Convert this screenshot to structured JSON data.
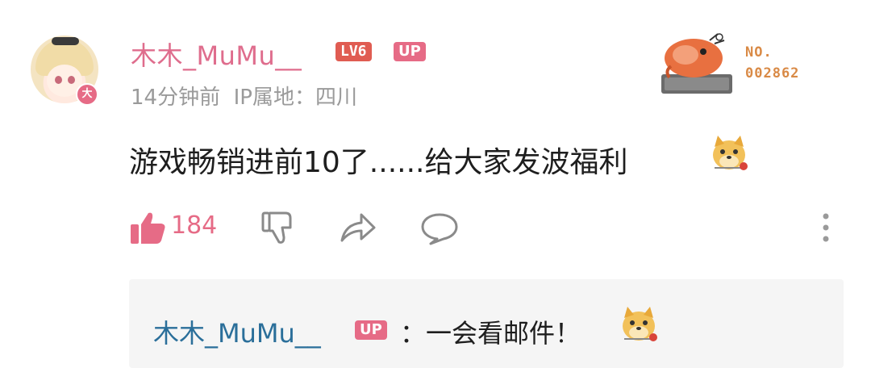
{
  "post": {
    "username": "木木_MuMu__",
    "level_badge": "LV6",
    "up_badge": "UP",
    "avatar_badge": "大",
    "time": "14分钟前",
    "ip_location": "IP属地：四川",
    "content": "游戏畅销进前10了......给大家发波福利",
    "content_emoji": "doge-emoji"
  },
  "decoration": {
    "line1": "NO.",
    "line2": "002862"
  },
  "actions": {
    "like_count": "184",
    "icons": [
      "thumbs-up-icon",
      "thumbs-down-icon",
      "share-icon",
      "comment-icon",
      "more-icon"
    ]
  },
  "reply": {
    "username": "木木_MuMu__",
    "up_badge": "UP",
    "text": "：一会看邮件！",
    "emoji": "doge-emoji"
  },
  "colors": {
    "accent_pink": "#e66b86",
    "level_red": "#e05c52",
    "reply_blue": "#2b6f9a",
    "meta_gray": "#9a9a9a"
  }
}
